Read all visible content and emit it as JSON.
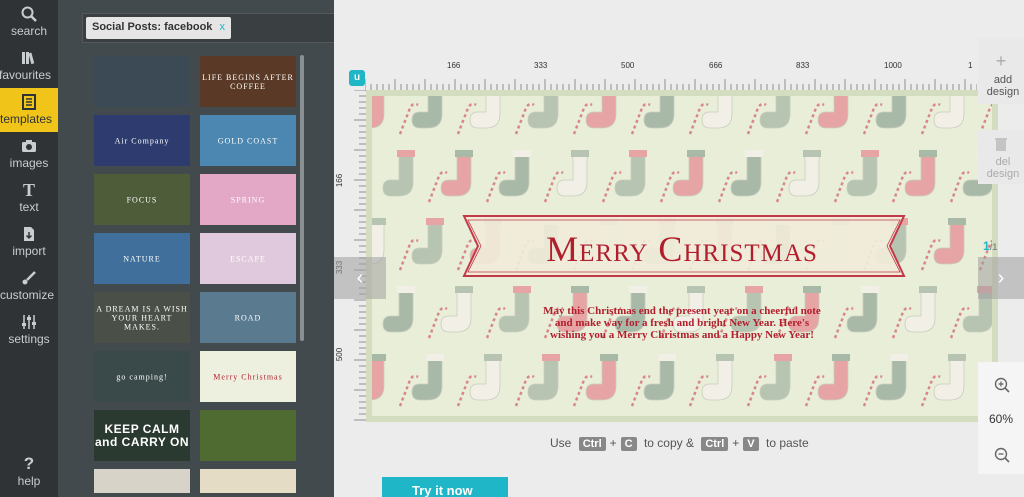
{
  "rail": {
    "items": [
      {
        "label": "search",
        "icon": "search-icon"
      },
      {
        "label": "favourites",
        "icon": "books-icon"
      },
      {
        "label": "templates",
        "icon": "templates-icon",
        "active": true
      },
      {
        "label": "images",
        "icon": "camera-icon"
      },
      {
        "label": "text",
        "icon": "text-icon"
      },
      {
        "label": "import",
        "icon": "import-icon"
      },
      {
        "label": "customize",
        "icon": "brush-icon"
      },
      {
        "label": "settings",
        "icon": "sliders-icon"
      }
    ],
    "help_label": "help",
    "help_glyph": "?",
    "text_glyph": "T"
  },
  "panel": {
    "filter_chip": "Social Posts: facebook",
    "chip_close": "x",
    "thumbnails": [
      {
        "text": "",
        "bg": "#3c4a55"
      },
      {
        "text": "LIFE BEGINS AFTER COFFEE",
        "bg": "#5a3a26"
      },
      {
        "text": "Air Company",
        "bg": "#2d3b6e"
      },
      {
        "text": "GOLD COAST",
        "bg": "#4b87b0"
      },
      {
        "text": "FOCUS",
        "bg": "#4f5c3a"
      },
      {
        "text": "SPRING",
        "bg": "#e3a8c6"
      },
      {
        "text": "NATURE",
        "bg": "#3f6f9a"
      },
      {
        "text": "ESCAPE",
        "bg": "#e0c9dc"
      },
      {
        "text": "A DREAM IS A WISH YOUR HEART MAKES.",
        "bg": "#4a5048"
      },
      {
        "text": "ROAD",
        "bg": "#5a7a90"
      },
      {
        "text": "go camping!",
        "bg": "#3a4a4a"
      },
      {
        "text": "Merry Christmas",
        "bg": "#eef0df"
      },
      {
        "text": "KEEP CALM and CARRY ON",
        "bg": "#2a3a30"
      },
      {
        "text": "",
        "bg": "#4f6b32"
      },
      {
        "text": "",
        "bg": "#d8d3c8"
      },
      {
        "text": "",
        "bg": "#e4dcc4"
      }
    ]
  },
  "ruler": {
    "h_ticks": [
      "166",
      "333",
      "500",
      "666",
      "833",
      "1000",
      "1"
    ],
    "v_ticks": [
      "166",
      "333",
      "500"
    ]
  },
  "design": {
    "title": "Merry Christmas",
    "message_lines": [
      "May this Christmas end the present year on a cheerful note",
      "and make way for a fresh and bright New Year. Here's",
      "wishing you a Merry Christmas and a Happy New Year!"
    ],
    "bg_color": "#e8eed7",
    "accent_color": "#b11e2d"
  },
  "tools": {
    "add_label": "add design",
    "del_label": "del design",
    "page_count": "1",
    "page_total": "/1",
    "zoom": "60%",
    "prev_glyph": "‹",
    "next_glyph": "›",
    "plus_glyph": "+"
  },
  "hint": {
    "use": "Use",
    "ctrl": "Ctrl",
    "plus": "+",
    "c_key": "C",
    "copy": "to copy &",
    "v_key": "V",
    "paste": "to paste"
  },
  "cta": {
    "label": "Try it now"
  },
  "colors": {
    "brand": "#1fb6c7",
    "active": "#f0c419",
    "rail": "#2f3336",
    "panel": "#434a4e"
  }
}
